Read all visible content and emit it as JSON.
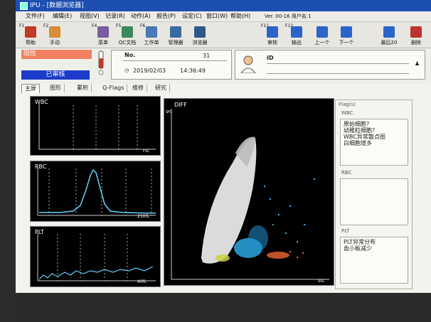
{
  "window": {
    "title": "IPU - [数据浏览器]",
    "version": "Ver. 00-16 用户名:1"
  },
  "menu": [
    "文件(F)",
    "编辑(E)",
    "视图(V)",
    "记录(R)",
    "动作(A)",
    "报告(P)",
    "设定(C)",
    "窗口(W)",
    "帮助(H)"
  ],
  "toolbar": {
    "left": [
      {
        "key": "F1",
        "label": "帮助",
        "icon": "help-book-icon",
        "color": "#c0392b"
      },
      {
        "key": "F2",
        "label": "手动",
        "icon": "manual-hand-icon",
        "color": "#d98c3a"
      }
    ],
    "mid": [
      {
        "key": "F4",
        "label": "菜单",
        "icon": "menu-icon",
        "color": "#7a5da0"
      },
      {
        "key": "F5",
        "label": "QC文档",
        "icon": "qc-doc-icon",
        "color": "#3a8a5a"
      },
      {
        "key": "F6",
        "label": "工作单",
        "icon": "worksheet-icon",
        "color": "#4a78b8"
      },
      {
        "key": "",
        "label": "管理器",
        "icon": "manager-icon",
        "color": "#3a6aa0"
      },
      {
        "key": "",
        "label": "浏览器",
        "icon": "browser-icon",
        "color": "#2a5a8a"
      }
    ],
    "right": [
      {
        "key": "F11",
        "label": "审核",
        "icon": "review-check-icon",
        "color": "#2a64c8"
      },
      {
        "key": "F12",
        "label": "输出",
        "icon": "output-icon",
        "color": "#2a64c8"
      },
      {
        "key": "",
        "label": "上一个",
        "icon": "arrow-up-icon",
        "color": "#2a64c8"
      },
      {
        "key": "",
        "label": "下一个",
        "icon": "arrow-down-icon",
        "color": "#2a64c8"
      },
      {
        "key": "",
        "label": "最后20",
        "icon": "last20-icon",
        "color": "#2a64c8"
      },
      {
        "key": "",
        "label": "删除",
        "icon": "delete-icon",
        "color": "#c03030"
      }
    ]
  },
  "sample": {
    "status": "阳性",
    "review": "已审核",
    "no_label": "No.",
    "no": "31",
    "date": "2019/02/03",
    "time": "14:36:49"
  },
  "patient": {
    "id_label": "ID"
  },
  "tabs": [
    "主屏",
    "图形",
    "累积",
    "Q-Flags",
    "维修",
    "研究"
  ],
  "panels": {
    "wbc": "WBC",
    "rbc": "RBC",
    "plt": "PLT",
    "diff": "DIFF",
    "rbc_unit": "250fL",
    "plt_unit": "40fL",
    "wbc_xaxis": "FSC",
    "diff_yaxis": "SFL",
    "diff_xaxis": "SSC"
  },
  "flags": {
    "title": "Flag(s)",
    "wbc_label": "WBC",
    "wbc_flags": [
      "原始细胞?",
      "幼稚粒细胞?",
      "WBC异常散点图",
      "白细胞增多"
    ],
    "rbc_label": "RBC",
    "plt_label": "PLT",
    "plt_flags": [
      "PLT异常分布",
      "血小板减少"
    ]
  }
}
